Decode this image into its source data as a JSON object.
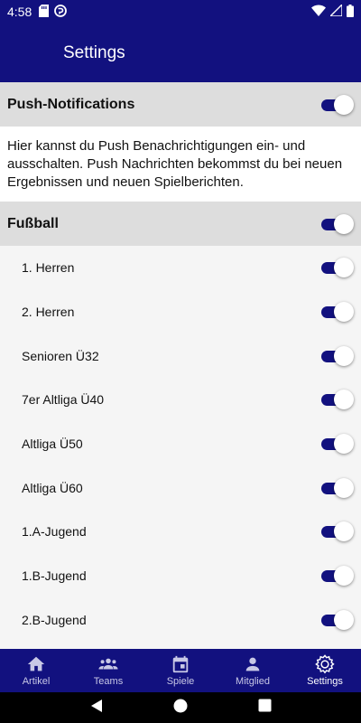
{
  "status_bar": {
    "time": "4:58"
  },
  "app_bar": {
    "title": "Settings"
  },
  "push": {
    "label": "Push-Notifications",
    "enabled": true,
    "description": "Hier kannst du Push Benachrichtigungen ein- und ausschalten. Push Nachrichten bekommst du bei neuen Ergebnissen und neuen Spielberichten."
  },
  "fussball": {
    "label": "Fußball",
    "enabled": true,
    "teams": [
      {
        "label": "1. Herren",
        "enabled": true
      },
      {
        "label": "2. Herren",
        "enabled": true
      },
      {
        "label": "Senioren Ü32",
        "enabled": true
      },
      {
        "label": "7er Altliga Ü40",
        "enabled": true
      },
      {
        "label": "Altliga Ü50",
        "enabled": true
      },
      {
        "label": "Altliga Ü60",
        "enabled": true
      },
      {
        "label": "1.A-Jugend",
        "enabled": true
      },
      {
        "label": "1.B-Jugend",
        "enabled": true
      },
      {
        "label": "2.B-Jugend",
        "enabled": true
      }
    ]
  },
  "bottom_nav": {
    "items": [
      {
        "label": "Artikel",
        "icon": "home-icon"
      },
      {
        "label": "Teams",
        "icon": "people-icon"
      },
      {
        "label": "Spiele",
        "icon": "calendar-icon"
      },
      {
        "label": "Mitglied",
        "icon": "person-icon"
      },
      {
        "label": "Settings",
        "icon": "gear-icon",
        "active": true
      }
    ]
  },
  "colors": {
    "primary": "#12117f",
    "section_bg": "#dddddd",
    "list_bg": "#f5f5f5"
  }
}
